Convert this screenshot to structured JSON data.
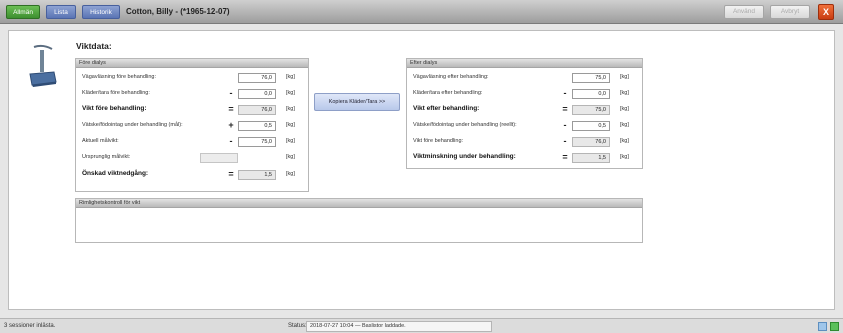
{
  "tabs": {
    "allman": "Allmän",
    "lista": "Lista",
    "historik": "Historik"
  },
  "patient_title": "Cotton, Billy - (*1965-12-07)",
  "toolbar": {
    "anvand": "Använd",
    "avbryt": "Avbryt",
    "close": "X"
  },
  "section_title": "Viktdata:",
  "fore": {
    "header": "Före dialys",
    "rows": [
      {
        "label": "Vägavläsning före behandling:",
        "op": "",
        "value": "76,0",
        "unit": "[kg]"
      },
      {
        "label": "Kläder/tara före behandling:",
        "op": "-",
        "value": "0,0",
        "unit": "[kg]"
      },
      {
        "label": "Vikt före behandling:",
        "op": "=",
        "value": "76,0",
        "unit": "[kg]"
      },
      {
        "label": "Vätske/födointag under behandling (mål):",
        "op": "+",
        "value": "0,5",
        "unit": "[kg]"
      },
      {
        "label": "Aktuell målvikt:",
        "op": "-",
        "value": "75,0",
        "unit": "[kg]"
      },
      {
        "label": "Ursprunglig målvikt:",
        "op": "",
        "value": "",
        "unit": "[kg]"
      },
      {
        "label": "Önskad viktnedgång:",
        "op": "=",
        "value": "1,5",
        "unit": "[kg]"
      }
    ]
  },
  "copy_button": "Kopiera Kläder/Tara >>",
  "efter": {
    "header": "Efter dialys",
    "rows": [
      {
        "label": "Vägavläsning efter behandling:",
        "op": "",
        "value": "75,0",
        "unit": "[kg]"
      },
      {
        "label": "Kläder/tara efter behandling:",
        "op": "-",
        "value": "0,0",
        "unit": "[kg]"
      },
      {
        "label": "Vikt efter behandling:",
        "op": "=",
        "value": "75,0",
        "unit": "[kg]"
      },
      {
        "label": "Vätske/födointag under behandling (reellt):",
        "op": "-",
        "value": "0,5",
        "unit": "[kg]"
      },
      {
        "label": "Vikt före behandling:",
        "op": "-",
        "value": "76,0",
        "unit": "[kg]"
      },
      {
        "label": "Viktminskning under behandling:",
        "op": "=",
        "value": "1,5",
        "unit": "[kg]"
      }
    ]
  },
  "rimlighet": {
    "header": "Rimlighetskontroll för vikt"
  },
  "statusbar": {
    "left": "3 sessioner inlästa.",
    "status_label": "Status:",
    "status_text": "2018-07-27 10:04 — Baslistor laddade."
  }
}
